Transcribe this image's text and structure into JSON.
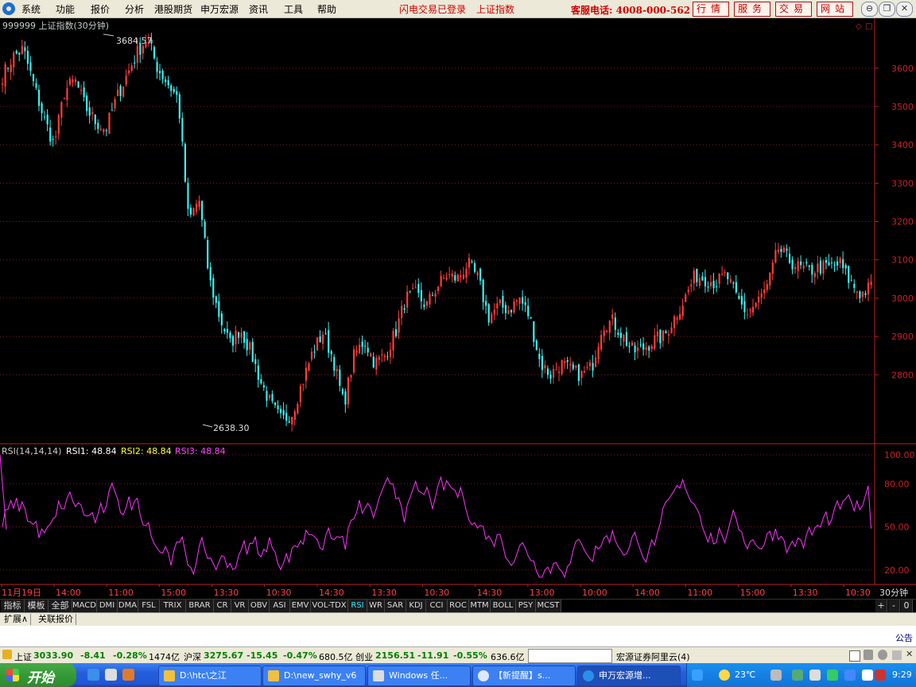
{
  "menu": {
    "items": [
      "系统",
      "功能",
      "报价",
      "分析",
      "港股期货",
      "申万宏源",
      "资讯",
      "工具",
      "帮助"
    ],
    "login_status": "闪电交易已登录",
    "index_name": "上证指数",
    "hotline": "客服电话: 4008-000-562",
    "top_buttons": [
      "行情",
      "服务",
      "交易",
      "网站"
    ]
  },
  "main_chart": {
    "title": "999999 上证指数(30分钟)",
    "high_label": "3684.57",
    "low_label": "2638.30",
    "high_value": 3684.57,
    "low_value": 2638.3
  },
  "rsi": {
    "name": "RSI(14,14,14)",
    "rsi1": "RSI1: 48.84",
    "rsi2": "RSI2: 48.84",
    "rsi3": "RSI3: 48.84"
  },
  "time_axis": [
    "11月19日",
    "14:00",
    "11:00",
    "15:00",
    "13:30",
    "10:30",
    "14:30",
    "13:30",
    "10:30",
    "14:30",
    "13:00",
    "10:00",
    "14:00",
    "11:00",
    "15:00",
    "13:30",
    "10:30"
  ],
  "period_label": "30分钟",
  "indicator_tabs": [
    "指标",
    "模板",
    "全部",
    "MACD",
    "DMI",
    "DMA",
    "FSL",
    "TRIX",
    "BRAR",
    "CR",
    "VR",
    "OBV",
    "ASI",
    "EMV",
    "VOL-TDX",
    "RSI",
    "WR",
    "SAR",
    "KDJ",
    "CCI",
    "ROC",
    "MTM",
    "BOLL",
    "PSY",
    "MCST"
  ],
  "active_tab": "RSI",
  "right_controls": [
    "+",
    "-",
    "0"
  ],
  "ext_tabs": [
    "扩展∧",
    "关联报价"
  ],
  "notice": "公告",
  "status": {
    "sh_label": "上证",
    "sh_value": "3033.90",
    "sh_change": "-8.41",
    "sh_pct": "-0.28%",
    "sh_amount": "1474亿",
    "hs_label": "沪深",
    "hs_value": "3275.67",
    "hs_change": "-15.45",
    "hs_pct": "-0.47%",
    "hs_amount": "680.5亿",
    "cy_label": "创业",
    "cy_value": "2156.51",
    "cy_change": "-11.91",
    "cy_pct": "-0.55%",
    "cy_amount": "636.6亿",
    "server": "宏源证券阿里云(4)"
  },
  "taskbar": {
    "start": "开始",
    "tasks": [
      "D:\\htc\\之江",
      "D:\\new_swhy_v6",
      "Windows 任...",
      "【新提醒】s...",
      "申万宏源增..."
    ],
    "weather": "23℃",
    "clock": "9:29"
  },
  "chart_data": {
    "type": "candlestick",
    "title": "999999 上证指数(30分钟)",
    "y_ticks": [
      3600,
      3500,
      3400,
      3300,
      3200,
      3100,
      3000,
      2900,
      2800
    ],
    "ylim": [
      2620,
      3720
    ],
    "high": 3684.57,
    "low": 2638.3,
    "x_labels": [
      "11月19日",
      "14:00",
      "11:00",
      "15:00",
      "13:30",
      "10:30",
      "14:30",
      "13:30",
      "10:30",
      "14:30",
      "13:00",
      "10:00",
      "14:00",
      "11:00",
      "15:00",
      "13:30",
      "10:30"
    ],
    "close_path": [
      3580,
      3630,
      3650,
      3560,
      3470,
      3400,
      3540,
      3570,
      3500,
      3460,
      3440,
      3520,
      3580,
      3640,
      3680,
      3600,
      3560,
      3520,
      3200,
      3260,
      3050,
      2950,
      2880,
      2920,
      2860,
      2780,
      2720,
      2680,
      2700,
      2780,
      2860,
      2910,
      2840,
      2720,
      2850,
      2890,
      2830,
      2850,
      2910,
      3000,
      3010,
      2980,
      3030,
      3060,
      3050,
      3090,
      3050,
      2950,
      2980,
      2970,
      3000,
      2950,
      2830,
      2800,
      2830,
      2810,
      2800,
      2820,
      2930,
      2940,
      2900,
      2860,
      2870,
      2890,
      2900,
      2950,
      3000,
      3060,
      3050,
      3040,
      3060,
      3000,
      2960,
      2990,
      3030,
      3130,
      3100,
      3080,
      3070,
      3080,
      3080,
      3090,
      3040,
      3010,
      3030
    ],
    "rsi": {
      "ylim": [
        10,
        105
      ],
      "y_ticks": [
        100.0,
        80.0,
        50.0,
        20.0
      ],
      "last": 48.84
    }
  }
}
